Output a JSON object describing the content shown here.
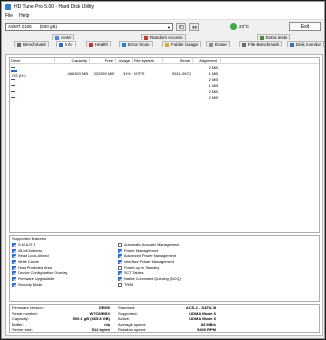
{
  "window": {
    "title": "HD Tune Pro 5.00 - Hard Disk Utility"
  },
  "menu": [
    "File",
    "Help"
  ],
  "toolbar": {
    "drive_name": "ASMT   2105",
    "drive_size": "(500 gB)",
    "temperature": "23°C",
    "exit_label": "Exit"
  },
  "tabs": [
    {
      "label": "AAM",
      "icon": "speaker-icon",
      "color": "#4f86d6"
    },
    {
      "label": "Random Access",
      "icon": "random-access-icon",
      "color": "#c23a2e"
    },
    {
      "label": "Extra tests",
      "icon": "extra-tests-icon",
      "color": "#4a8e3a"
    },
    {
      "label": "Benchmark",
      "icon": "benchmark-icon",
      "color": "#6a6a6a"
    },
    {
      "label": "Info",
      "icon": "info-icon",
      "color": "#2d6cd3"
    },
    {
      "label": "Health",
      "icon": "health-icon",
      "color": "#c8322e"
    },
    {
      "label": "Error Scan",
      "icon": "error-scan-icon",
      "color": "#2f7fd0"
    },
    {
      "label": "Folder Usage",
      "icon": "folder-icon",
      "color": "#d9a72c"
    },
    {
      "label": "Erase",
      "icon": "erase-icon",
      "color": "#8a8a8a"
    },
    {
      "label": "File Benchmark",
      "icon": "file-benchmark-icon",
      "color": "#6a6a6a"
    },
    {
      "label": "Disk monitor",
      "icon": "disk-monitor-icon",
      "color": "#3b6fb0"
    }
  ],
  "partitions": {
    "headers": [
      "Drive",
      "Capacity",
      "Free",
      "Usage",
      "File system",
      "Serial",
      "Alignment"
    ],
    "rows": [
      {
        "drive": "",
        "capacity": "",
        "free": "",
        "usage": "",
        "fs": "",
        "serial": "",
        "alignment": "2 MB"
      },
      {
        "drive": "OS (H:)",
        "capacity": "466393 MB",
        "free": "320350 MB",
        "usage": "31%",
        "fs": "NTFS",
        "serial": "5511-9672",
        "alignment": "1 MB"
      },
      {
        "drive": "",
        "capacity": "",
        "free": "",
        "usage": "",
        "fs": "",
        "serial": "",
        "alignment": "2 MB"
      },
      {
        "drive": "",
        "capacity": "",
        "free": "",
        "usage": "",
        "fs": "",
        "serial": "",
        "alignment": "1 MB"
      },
      {
        "drive": "",
        "capacity": "",
        "free": "",
        "usage": "",
        "fs": "",
        "serial": "",
        "alignment": "2 MB"
      },
      {
        "drive": "",
        "capacity": "",
        "free": "",
        "usage": "",
        "fs": "",
        "serial": "",
        "alignment": "2 MB"
      }
    ]
  },
  "features": {
    "title": "Supported features",
    "left": [
      {
        "label": "S.M.A.R.T",
        "checked": true
      },
      {
        "label": "48-bit Address",
        "checked": true
      },
      {
        "label": "Read Look-Ahead",
        "checked": true
      },
      {
        "label": "Write Cache",
        "checked": true
      },
      {
        "label": "Host Protected Area",
        "checked": true
      },
      {
        "label": "Device Configuration Overlay",
        "checked": true
      },
      {
        "label": "Firmware Upgradable",
        "checked": true
      },
      {
        "label": "Security Mode",
        "checked": true
      }
    ],
    "right": [
      {
        "label": "Automatic Acoustic Management",
        "checked": false
      },
      {
        "label": "Power Management",
        "checked": true
      },
      {
        "label": "Advanced Power Management",
        "checked": true
      },
      {
        "label": "Interface Power Management",
        "checked": true
      },
      {
        "label": "Power-up in Standby",
        "checked": false
      },
      {
        "label": "SCT Tables",
        "checked": true
      },
      {
        "label": "Native Command Queuing (NCQ)",
        "checked": true
      },
      {
        "label": "TRIM",
        "checked": false
      }
    ]
  },
  "info": {
    "left": [
      {
        "label": "Firmware version:",
        "value": "DEM9"
      },
      {
        "label": "Serial number:",
        "value": "W7CMEBX"
      },
      {
        "label": "Capacity:",
        "value": "500.1 gB (465.8 GB)"
      },
      {
        "label": "Buffer:",
        "value": "n/a"
      },
      {
        "label": "Sector size:",
        "value": "512 bytes"
      }
    ],
    "right": [
      {
        "label": "Standard:",
        "value": "ACS-2 - SATA III"
      },
      {
        "label": "Supported:",
        "value": "UDMA Mode 6"
      },
      {
        "label": "Active:",
        "value": "UDMA Mode 6"
      },
      {
        "label": "Average speed:",
        "value": "84 MB/s"
      },
      {
        "label": "Rotation speed:",
        "value": "5400 RPM"
      }
    ]
  }
}
